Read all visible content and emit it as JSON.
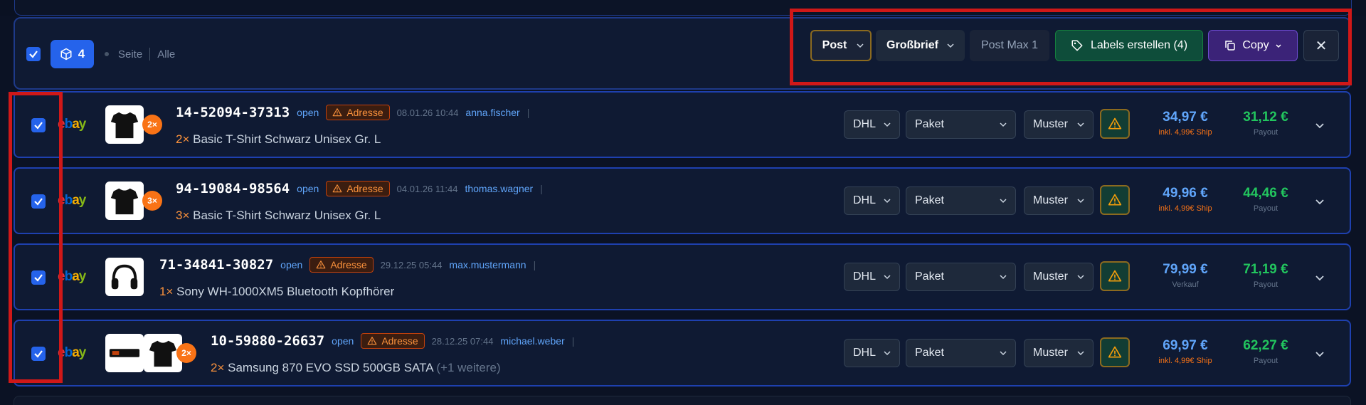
{
  "bulkbar": {
    "count": "4",
    "scope_page": "Seite",
    "scope_all": "Alle",
    "carrier_select": "Post",
    "format_select": "Großbrief",
    "product_button": "Post Max 1",
    "labels_button": "Labels erstellen (4)",
    "copy_button": "Copy",
    "close_button": "✕"
  },
  "colors": {
    "accent": "#2563eb",
    "highlight_box": "#d01818",
    "payout": "#22c55e",
    "price": "#60a5fa",
    "warning": "#fb923c"
  },
  "orders": [
    {
      "marketplace": "ebay",
      "order_number": "14-52094-37313",
      "status": "open",
      "warning": "Adresse",
      "date": "08.01.26 10:44",
      "user": "anna.fischer",
      "qty_badge": "2×",
      "qty_prefix": "2×",
      "product": "Basic T-Shirt Schwarz Unisex Gr. L",
      "more": "",
      "carrier": "DHL",
      "package_type": "Paket",
      "template": "Muster",
      "price": "34,97 €",
      "price_sub": "inkl. 4,99€ Ship",
      "payout": "31,12 €",
      "payout_label": "Payout",
      "thumbs": [
        "tshirt-icon"
      ]
    },
    {
      "marketplace": "ebay",
      "order_number": "94-19084-98564",
      "status": "open",
      "warning": "Adresse",
      "date": "04.01.26 11:44",
      "user": "thomas.wagner",
      "qty_badge": "3×",
      "qty_prefix": "3×",
      "product": "Basic T-Shirt Schwarz Unisex Gr. L",
      "more": "",
      "carrier": "DHL",
      "package_type": "Paket",
      "template": "Muster",
      "price": "49,96 €",
      "price_sub": "inkl. 4,99€ Ship",
      "payout": "44,46 €",
      "payout_label": "Payout",
      "thumbs": [
        "tshirt-icon"
      ]
    },
    {
      "marketplace": "ebay",
      "order_number": "71-34841-30827",
      "status": "open",
      "warning": "Adresse",
      "date": "29.12.25 05:44",
      "user": "max.mustermann",
      "qty_badge": "",
      "qty_prefix": "1×",
      "product": "Sony WH-1000XM5 Bluetooth Kopfhörer",
      "more": "",
      "carrier": "DHL",
      "package_type": "Paket",
      "template": "Muster",
      "price": "79,99 €",
      "price_sub": "Verkauf",
      "payout": "71,19 €",
      "payout_label": "Payout",
      "thumbs": [
        "headphones-icon"
      ]
    },
    {
      "marketplace": "ebay",
      "order_number": "10-59880-26637",
      "status": "open",
      "warning": "Adresse",
      "date": "28.12.25 07:44",
      "user": "michael.weber",
      "qty_badge": "2×",
      "qty_prefix": "2×",
      "product": "Samsung 870 EVO SSD 500GB SATA",
      "more": "(+1 weitere)",
      "carrier": "DHL",
      "package_type": "Paket",
      "template": "Muster",
      "price": "69,97 €",
      "price_sub": "inkl. 4,99€ Ship",
      "payout": "62,27 €",
      "payout_label": "Payout",
      "thumbs": [
        "ssd-icon",
        "tshirt-icon"
      ]
    }
  ]
}
